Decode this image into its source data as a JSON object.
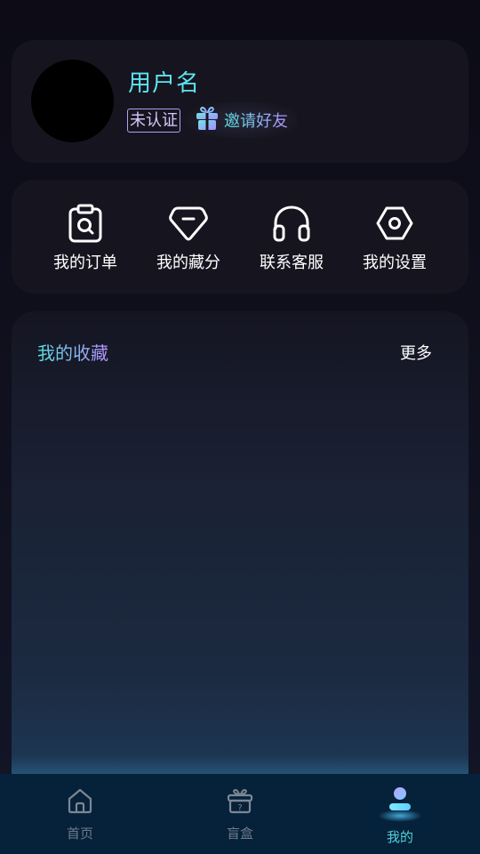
{
  "profile": {
    "username": "用户名",
    "verify_badge": "未认证",
    "invite_label": "邀请好友"
  },
  "menu": {
    "items": [
      {
        "label": "我的订单",
        "icon": "order-search-icon"
      },
      {
        "label": "我的藏分",
        "icon": "diamond-icon"
      },
      {
        "label": "联系客服",
        "icon": "headset-icon"
      },
      {
        "label": "我的设置",
        "icon": "settings-hexagon-icon"
      }
    ]
  },
  "favorites": {
    "title": "我的收藏",
    "more_label": "更多"
  },
  "tabbar": {
    "items": [
      {
        "label": "首页",
        "icon": "home-icon",
        "active": false
      },
      {
        "label": "盲盒",
        "icon": "mystery-box-icon",
        "active": false
      },
      {
        "label": "我的",
        "icon": "user-profile-icon",
        "active": true
      }
    ]
  },
  "colors": {
    "accent_cyan": "#5fe3f0",
    "accent_purple": "#b590ff",
    "card_bg": "#16151f",
    "tabbar_bg": "#06213a"
  }
}
